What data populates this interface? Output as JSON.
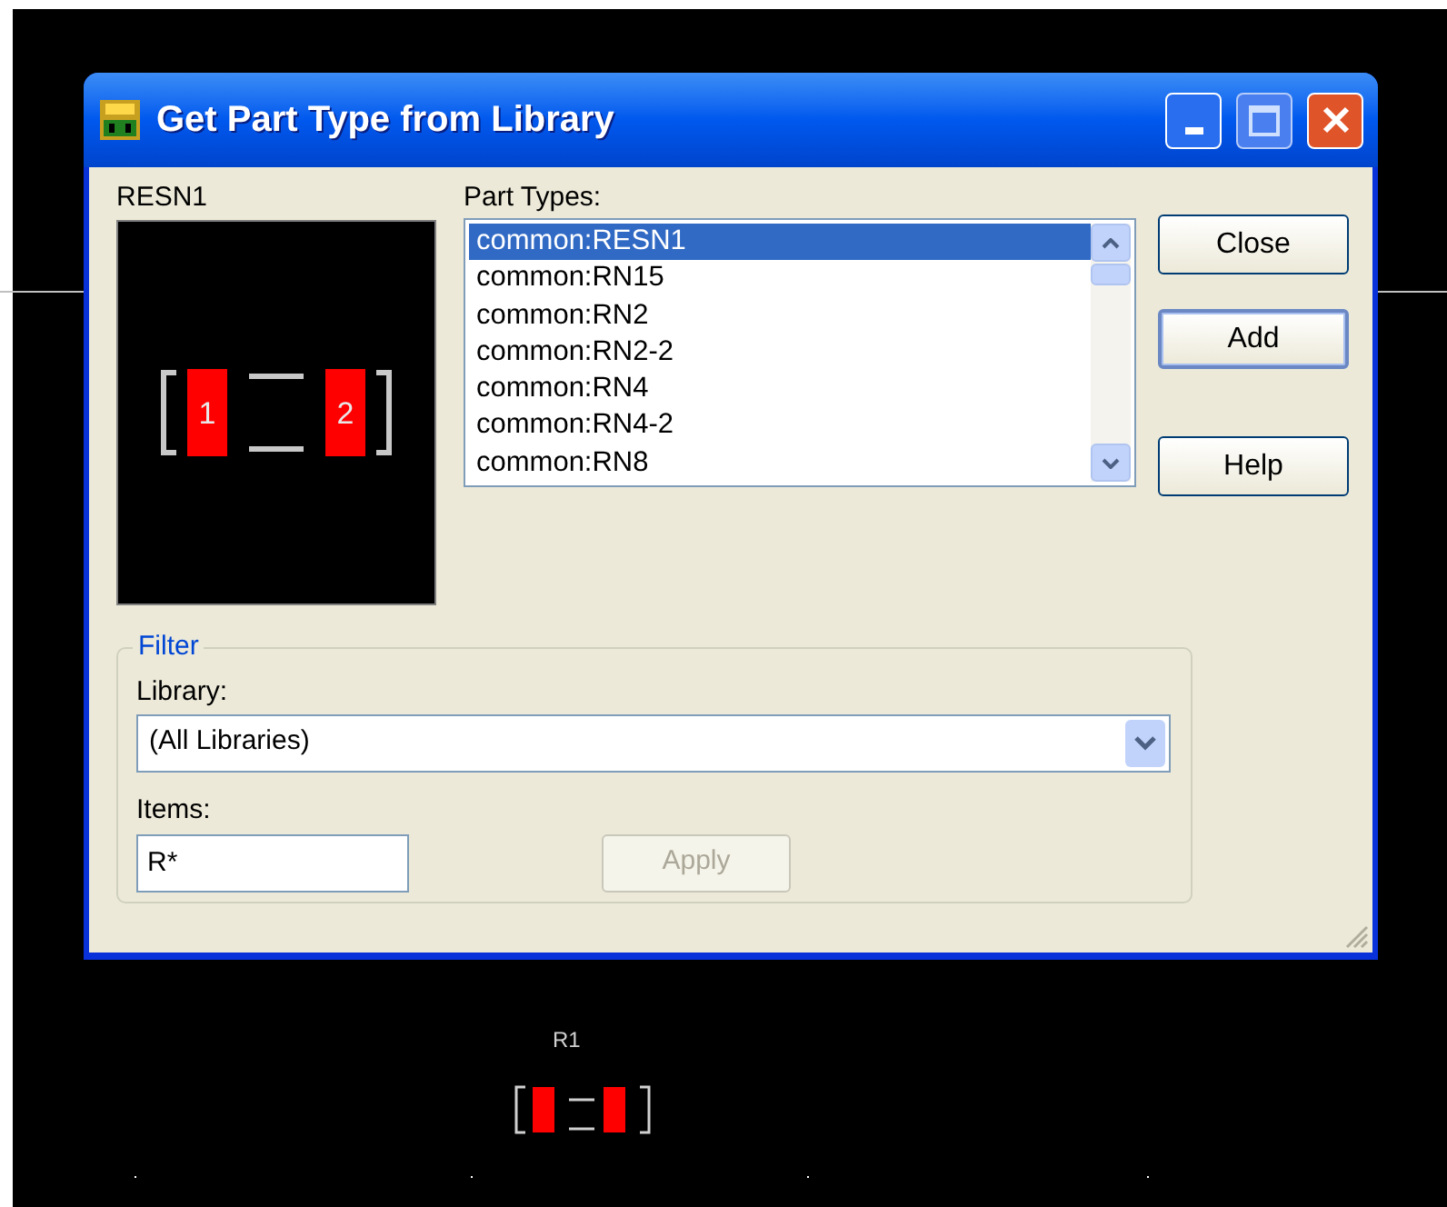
{
  "window": {
    "title": "Get Part Type from Library"
  },
  "preview": {
    "name": "RESN1",
    "pins": [
      "1",
      "2"
    ]
  },
  "part_types": {
    "label": "Part Types:",
    "items": [
      {
        "text": "common:RESN1",
        "selected": true
      },
      {
        "text": "common:RN15",
        "selected": false
      },
      {
        "text": "common:RN2",
        "selected": false
      },
      {
        "text": "common:RN2-2",
        "selected": false
      },
      {
        "text": "common:RN4",
        "selected": false
      },
      {
        "text": "common:RN4-2",
        "selected": false
      },
      {
        "text": "common:RN8",
        "selected": false
      }
    ]
  },
  "buttons": [
    {
      "label": "Close",
      "default": false
    },
    {
      "label": "Add",
      "default": true
    },
    {
      "label": "Help",
      "default": false
    }
  ],
  "filter": {
    "title": "Filter",
    "library_label": "Library:",
    "library_value": "(All Libraries)",
    "items_label": "Items:",
    "items_value": "R*",
    "apply": {
      "label": "Apply",
      "disabled": true
    }
  },
  "canvas": {
    "ref": "R1"
  }
}
